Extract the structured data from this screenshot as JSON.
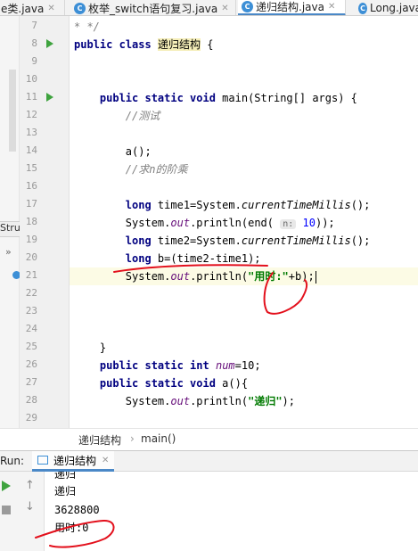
{
  "tabs": [
    {
      "label": "e类.java",
      "icon": "java-class-icon"
    },
    {
      "label": "枚举_switch语句复习.java",
      "icon": "java-class-icon"
    },
    {
      "label": "递归结构.java",
      "icon": "java-class-icon",
      "active": true
    },
    {
      "label": "Long.java",
      "icon": "java-class-icon"
    }
  ],
  "structure_panel": {
    "label": "Stru",
    "chevron": "»"
  },
  "gutter": {
    "line_numbers": [
      "7",
      "8",
      "9",
      "10",
      "11",
      "12",
      "13",
      "14",
      "15",
      "16",
      "17",
      "18",
      "19",
      "20",
      "21",
      "22",
      "23",
      "24",
      "25",
      "26",
      "27",
      "28",
      "29"
    ],
    "run_markers": [
      "8",
      "11"
    ]
  },
  "code": {
    "l7": "* */",
    "l8": {
      "kw1": "public",
      "kw2": "class",
      "name": "递归结构",
      "brace": " {"
    },
    "l11": {
      "kw": "public static void",
      "rest": " main(String[] args) {"
    },
    "l12": "//测试",
    "l14": "a();",
    "l15": "//求n的阶乘",
    "l17": {
      "kw": "long",
      "a": " time1=System.",
      "m": "currentTimeMillis",
      "b": "();"
    },
    "l18": {
      "a": "System.",
      "out": "out",
      "b": ".println(",
      "call": "end(",
      "hint": "n:",
      "num": " 10",
      "c": "));"
    },
    "l19": {
      "kw": "long",
      "a": " time2=System.",
      "m": "currentTimeMillis",
      "b": "();"
    },
    "l20": {
      "kw": "long",
      "a": " b=(time2-time1);"
    },
    "l21": {
      "a": "System.",
      "out": "out",
      "b": ".println(",
      "str": "\"用时:\"",
      "c": "+b);"
    },
    "l25": "}",
    "l26": {
      "kw": "public static int",
      "sp": " ",
      "fld": "num",
      "rest": "=10;"
    },
    "l27": {
      "kw": "public static void",
      "rest": " a(){"
    },
    "l28": {
      "a": "System.",
      "out": "out",
      "b": ".println(",
      "str": "\"递归\"",
      "c": ");"
    }
  },
  "breadcrumb": {
    "items": [
      "递归结构",
      "main()"
    ],
    "separator": "›"
  },
  "run_panel": {
    "label": "Run:",
    "tab_label": "递归结构"
  },
  "console_output": [
    "递归",
    "递归",
    "3628800",
    "用时:0"
  ],
  "colors": {
    "keyword": "#000080",
    "string": "#007a00",
    "comment": "#808080",
    "field": "#660e7a",
    "annotation_ink": "#e3101c",
    "run_green": "#3ea33e"
  }
}
